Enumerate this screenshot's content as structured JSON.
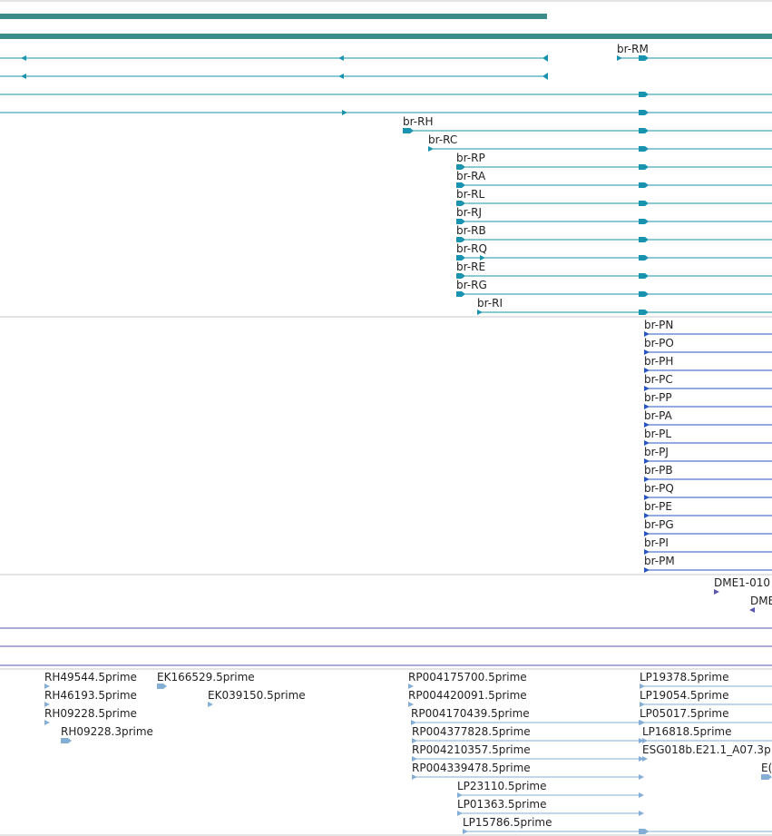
{
  "colors": {
    "gene_bar": "#3c8c8c",
    "transcript": "#1a93b0",
    "protein": "#2a55c0",
    "est": "#84aed6",
    "dme": "#5a55b0",
    "separator": "#c8c8c8"
  },
  "transcripts_a": [
    {
      "label": ""
    },
    {
      "label": ""
    },
    {
      "label": ""
    },
    {
      "label": ""
    },
    {
      "label": "br-RM"
    },
    {
      "label": "br-RH"
    },
    {
      "label": "br-RC"
    },
    {
      "label": "br-RP"
    },
    {
      "label": "br-RA"
    },
    {
      "label": "br-RL"
    },
    {
      "label": "br-RJ"
    },
    {
      "label": "br-RB"
    },
    {
      "label": "br-RQ"
    },
    {
      "label": "br-RE"
    },
    {
      "label": "br-RG"
    },
    {
      "label": "br-RI"
    }
  ],
  "proteins": [
    {
      "label": "br-PN"
    },
    {
      "label": "br-PO"
    },
    {
      "label": "br-PH"
    },
    {
      "label": "br-PC"
    },
    {
      "label": "br-PP"
    },
    {
      "label": "br-PA"
    },
    {
      "label": "br-PL"
    },
    {
      "label": "br-PJ"
    },
    {
      "label": "br-PB"
    },
    {
      "label": "br-PQ"
    },
    {
      "label": "br-PE"
    },
    {
      "label": "br-PG"
    },
    {
      "label": "br-PI"
    },
    {
      "label": "br-PM"
    }
  ],
  "dme_features": [
    {
      "label": "DME1-010"
    },
    {
      "label": "DME"
    }
  ],
  "ests": [
    {
      "label": "RH49544.5prime"
    },
    {
      "label": "RH46193.5prime"
    },
    {
      "label": "RH09228.5prime"
    },
    {
      "label": "RH09228.3prime"
    },
    {
      "label": "EK166529.5prime"
    },
    {
      "label": "EK039150.5prime"
    },
    {
      "label": "RP004175700.5prime"
    },
    {
      "label": "RP004420091.5prime"
    },
    {
      "label": "RP004170439.5prime"
    },
    {
      "label": "RP004377828.5prime"
    },
    {
      "label": "RP004210357.5prime"
    },
    {
      "label": "RP004339478.5prime"
    },
    {
      "label": "LP23110.5prime"
    },
    {
      "label": "LP01363.5prime"
    },
    {
      "label": "LP15786.5prime"
    },
    {
      "label": "LP19378.5prime"
    },
    {
      "label": "LP19054.5prime"
    },
    {
      "label": "LP05017.5prime"
    },
    {
      "label": "LP16818.5prime"
    },
    {
      "label": "ESG018b.E21.1_A07.3p"
    },
    {
      "label": "E("
    }
  ]
}
